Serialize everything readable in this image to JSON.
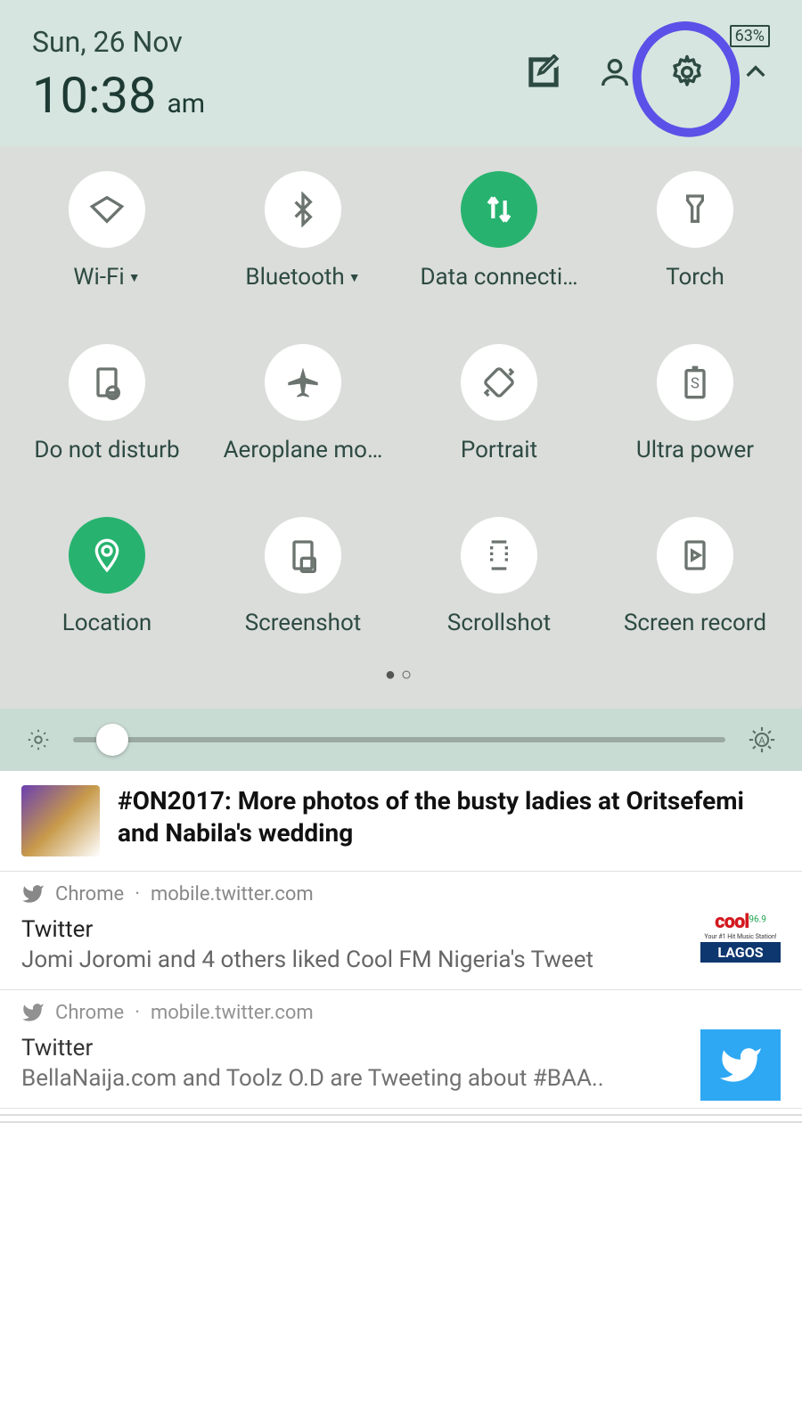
{
  "status": {
    "battery": "63%"
  },
  "header": {
    "date": "Sun, 26 Nov",
    "time": "10:38",
    "ampm": "am"
  },
  "qs": {
    "tiles": [
      {
        "label": "Wi-Fi",
        "dropdown": true
      },
      {
        "label": "Bluetooth",
        "dropdown": true
      },
      {
        "label": "Data connecti…",
        "dropdown": false
      },
      {
        "label": "Torch",
        "dropdown": false
      },
      {
        "label": "Do not disturb",
        "dropdown": false
      },
      {
        "label": "Aeroplane mo…",
        "dropdown": false
      },
      {
        "label": "Portrait",
        "dropdown": false
      },
      {
        "label": "Ultra power",
        "dropdown": false
      },
      {
        "label": "Location",
        "dropdown": false
      },
      {
        "label": "Screenshot",
        "dropdown": false
      },
      {
        "label": "Scrollshot",
        "dropdown": false
      },
      {
        "label": "Screen record",
        "dropdown": false
      }
    ]
  },
  "news": {
    "title": "#ON2017: More photos of the busty ladies at Oritsefemi and Nabila's wedding"
  },
  "notifications": [
    {
      "app": "Chrome",
      "site": "mobile.twitter.com",
      "title": "Twitter",
      "body": "Jomi Joromi and 4 others liked Cool FM Nigeria's Tweet",
      "logo": {
        "brand": "cool",
        "freq": "96.9",
        "tag": "LAGOS"
      }
    },
    {
      "app": "Chrome",
      "site": "mobile.twitter.com",
      "title": "Twitter",
      "body": "BellaNaija.com and Toolz O.D are Tweeting about #BAA.."
    }
  ]
}
